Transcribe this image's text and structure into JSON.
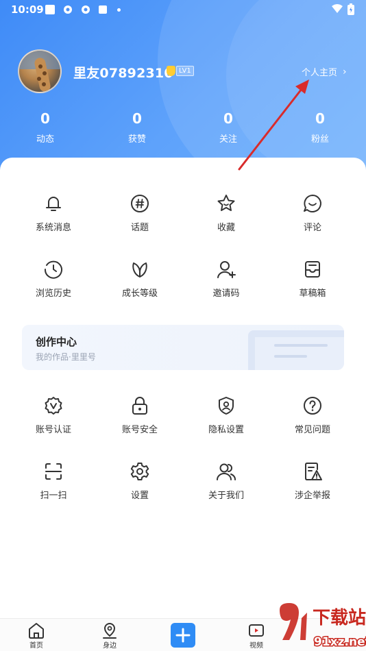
{
  "status_bar": {
    "time": "10:09"
  },
  "profile": {
    "username": "里友07892310",
    "level": "LV1",
    "home_link": "个人主页"
  },
  "stats": [
    {
      "value": "0",
      "label": "动态"
    },
    {
      "value": "0",
      "label": "获赞"
    },
    {
      "value": "0",
      "label": "关注"
    },
    {
      "value": "0",
      "label": "粉丝"
    }
  ],
  "grid_top": [
    {
      "label": "系统消息",
      "icon": "bell-icon"
    },
    {
      "label": "话题",
      "icon": "hashtag-icon"
    },
    {
      "label": "收藏",
      "icon": "star-icon"
    },
    {
      "label": "评论",
      "icon": "comment-icon"
    },
    {
      "label": "浏览历史",
      "icon": "history-icon"
    },
    {
      "label": "成长等级",
      "icon": "leaf-icon"
    },
    {
      "label": "邀请码",
      "icon": "add-user-icon"
    },
    {
      "label": "草稿箱",
      "icon": "drafts-icon"
    }
  ],
  "creator_center": {
    "title": "创作中心",
    "subtitle": "我的作品·里里号"
  },
  "grid_bottom": [
    {
      "label": "账号认证",
      "icon": "verify-badge-icon"
    },
    {
      "label": "账号安全",
      "icon": "lock-icon"
    },
    {
      "label": "隐私设置",
      "icon": "shield-user-icon"
    },
    {
      "label": "常见问题",
      "icon": "question-icon"
    },
    {
      "label": "扫一扫",
      "icon": "scan-icon"
    },
    {
      "label": "设置",
      "icon": "gear-icon"
    },
    {
      "label": "关于我们",
      "icon": "group-icon"
    },
    {
      "label": "涉企举报",
      "icon": "report-icon"
    }
  ],
  "bottom_nav": [
    {
      "label": "首页",
      "icon": "home-icon"
    },
    {
      "label": "身边",
      "icon": "location-icon"
    },
    {
      "label": "",
      "icon": "plus-icon"
    },
    {
      "label": "视频",
      "icon": "video-icon"
    }
  ],
  "watermark": {
    "text_top": "下载站",
    "text_bottom": "91xz.net"
  },
  "colors": {
    "header_blue": "#4a90f8",
    "accent": "#2f8cf5",
    "arrow": "#d92b2b"
  }
}
